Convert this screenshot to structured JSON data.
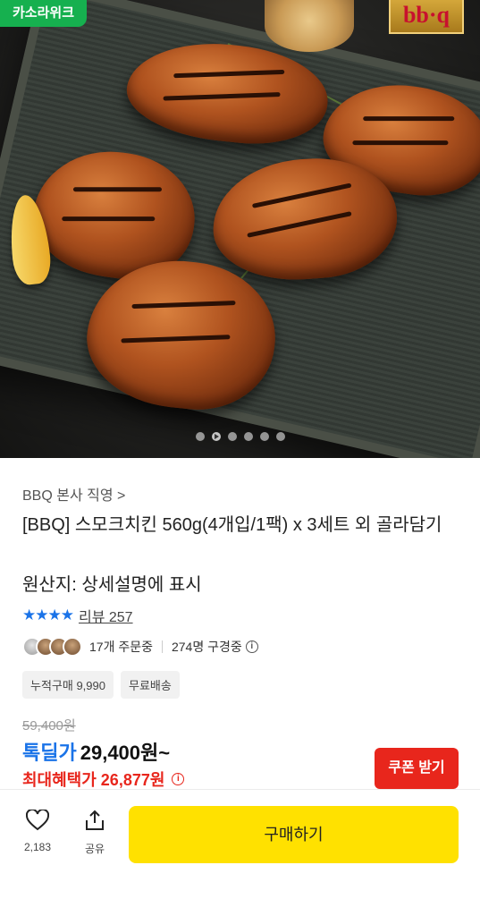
{
  "hero": {
    "store_badge": "카소라위크",
    "brand_badge": "bb·q",
    "carousel_count": 6,
    "carousel_active": 2
  },
  "product": {
    "seller": "BBQ 본사 직영 >",
    "title": "[BBQ] 스모크치킨 560g(4개입/1팩) x 3세트 외 골라담기",
    "origin": "원산지: 상세설명에 표시",
    "stars": "★★★★",
    "review": "리뷰 257",
    "orders": "17개 주문중",
    "watchers": "274명 구경중",
    "tags": [
      "누적구매 9,990",
      "무료배송"
    ],
    "original_price": "59,400원",
    "deal_label": "톡딜가",
    "deal_price": "29,400원~",
    "max_benefit": "최대혜택가 26,877원",
    "coupon_button": "쿠폰 받기"
  },
  "bottom_bar": {
    "like_count": "2,183",
    "share_label": "공유",
    "buy_button": "구매하기"
  },
  "colors": {
    "accent_blue": "#1a73e8",
    "accent_red": "#e8261c",
    "buy_yellow": "#ffe100",
    "store_green": "#16b04f"
  }
}
